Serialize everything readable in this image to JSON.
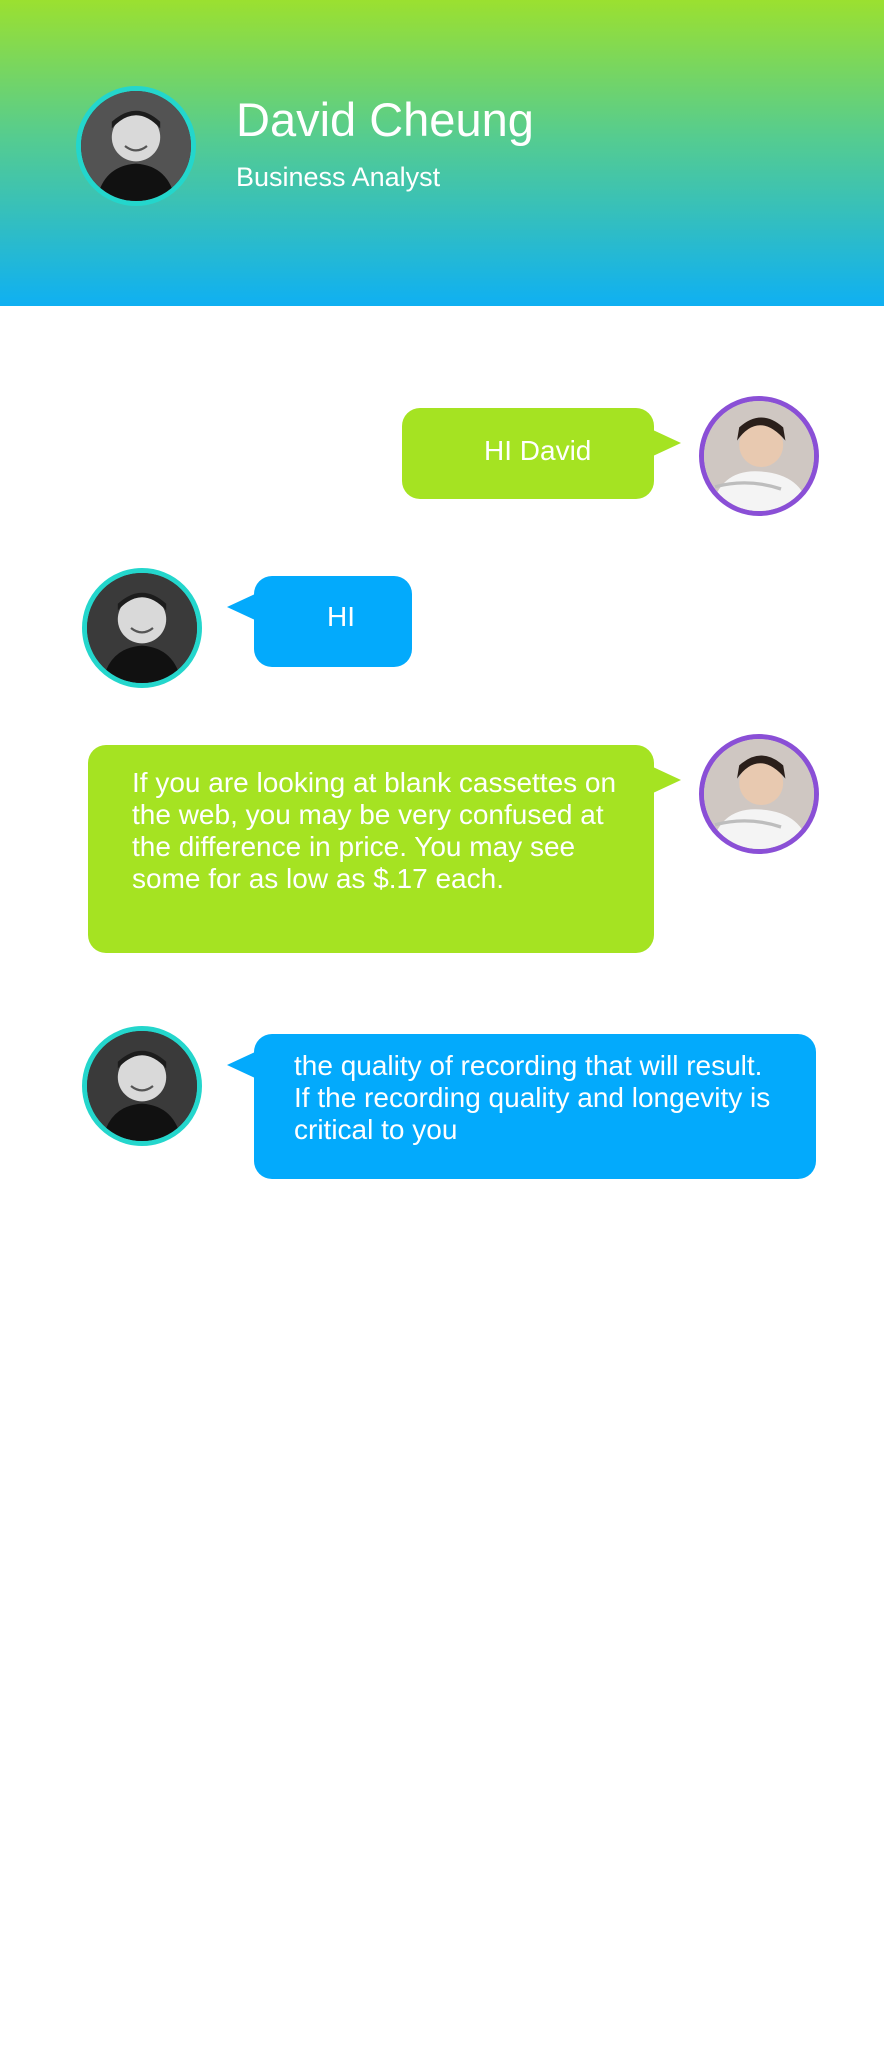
{
  "contact": {
    "name": "David Cheung",
    "title": "Business Analyst"
  },
  "colors": {
    "header_gradient": [
      "#9be030",
      "#0fb0f2"
    ],
    "outgoing_bubble": "#a5e322",
    "incoming_bubble": "#03aafc",
    "contact_avatar_ring": "#24d6cc",
    "user_avatar_ring": "#8a4fd6"
  },
  "messages": [
    {
      "from": "me",
      "text": "HI David"
    },
    {
      "from": "contact",
      "text": "HI"
    },
    {
      "from": "me",
      "text": "If you are looking at blank cassettes on the web, you may be very confused at the difference in price. You may see some for as low as $.17 each."
    },
    {
      "from": "contact",
      "text": "the quality of recording that will result. If the recording quality and longevity is critical to you"
    }
  ]
}
